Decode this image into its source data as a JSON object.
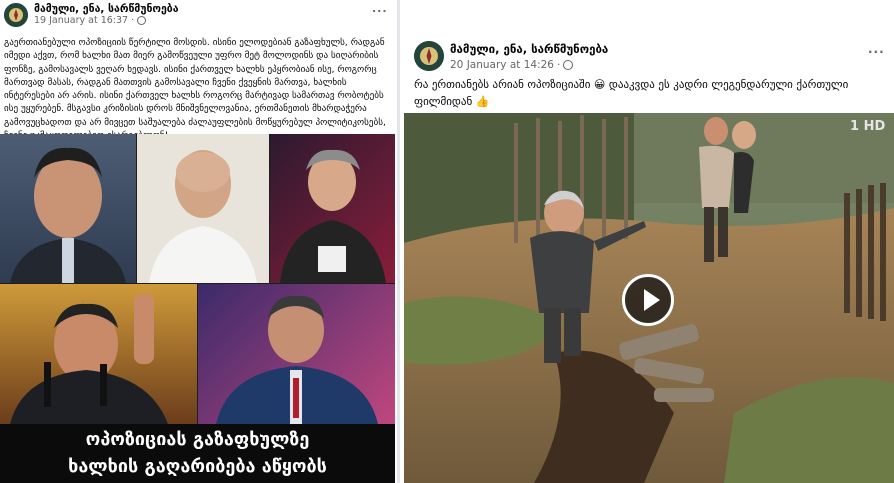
{
  "left_post": {
    "page_name": "მამული, ენა, სარწმუნოება",
    "date": "19 January at 16:37",
    "separator": "·",
    "privacy_icon": "globe-icon",
    "more_label": "...",
    "text": "გაერთიანებული ოპოზიციის წერტილი მოსდის. ისინი ელოდებიან გაზაფხულს, რადგან იმედი აქვთ, რომ ხალხი მათ მიერ გამოწვეული უფრო მეტ მოლოდინს და სიღარიბის ფონზე, გამოსავალს ვეღარ ხედავს. ისინი ქართველ ხალხს ეპყრობიან ისე, როგორც მართვად მასას, რადგან მათთვის გამოსავალი ჩვენი ქვეყნის მართვა, ხალხის ინტერესები არ არის. ისინი ქართველ ხალხს როგორც მარტივად სამართავ რობოტებს ისე უყურებენ. მსგავსი კრიზისის დროს მნიშვნელოვანია, ერთმანეთის მხარდაჭერა გამოვუცხადოთ და არ მივცეთ საშუალება ძალაუფლების მოწყურებულ პოლიტიკოსებს, ჩვენი უკმაყოფილებით ისარგებლონ!",
    "image_caption_line1": "ოპოზიციას გაზაფხულზე",
    "image_caption_line2": "ხალხის გაღარიბება აწყობს"
  },
  "right_post": {
    "page_name": "მამული, ენა, სარწმუნოება",
    "date": "20 January at 14:26",
    "separator": "·",
    "privacy_icon": "globe-icon",
    "more_label": "...",
    "text_line1": "რა ერთიანებს არიან ოპოზიციაში 😀 დააკვდა ეს კადრი ლეგენდარული ქართული",
    "text_line2": "ფილმიდან 👍",
    "channel_logo": "1 HD",
    "play_icon": "play-icon"
  },
  "colors": {
    "name": "#050505",
    "meta": "#65676b",
    "divider": "#e4e6eb",
    "caption_bg": "#0b0b0b"
  }
}
